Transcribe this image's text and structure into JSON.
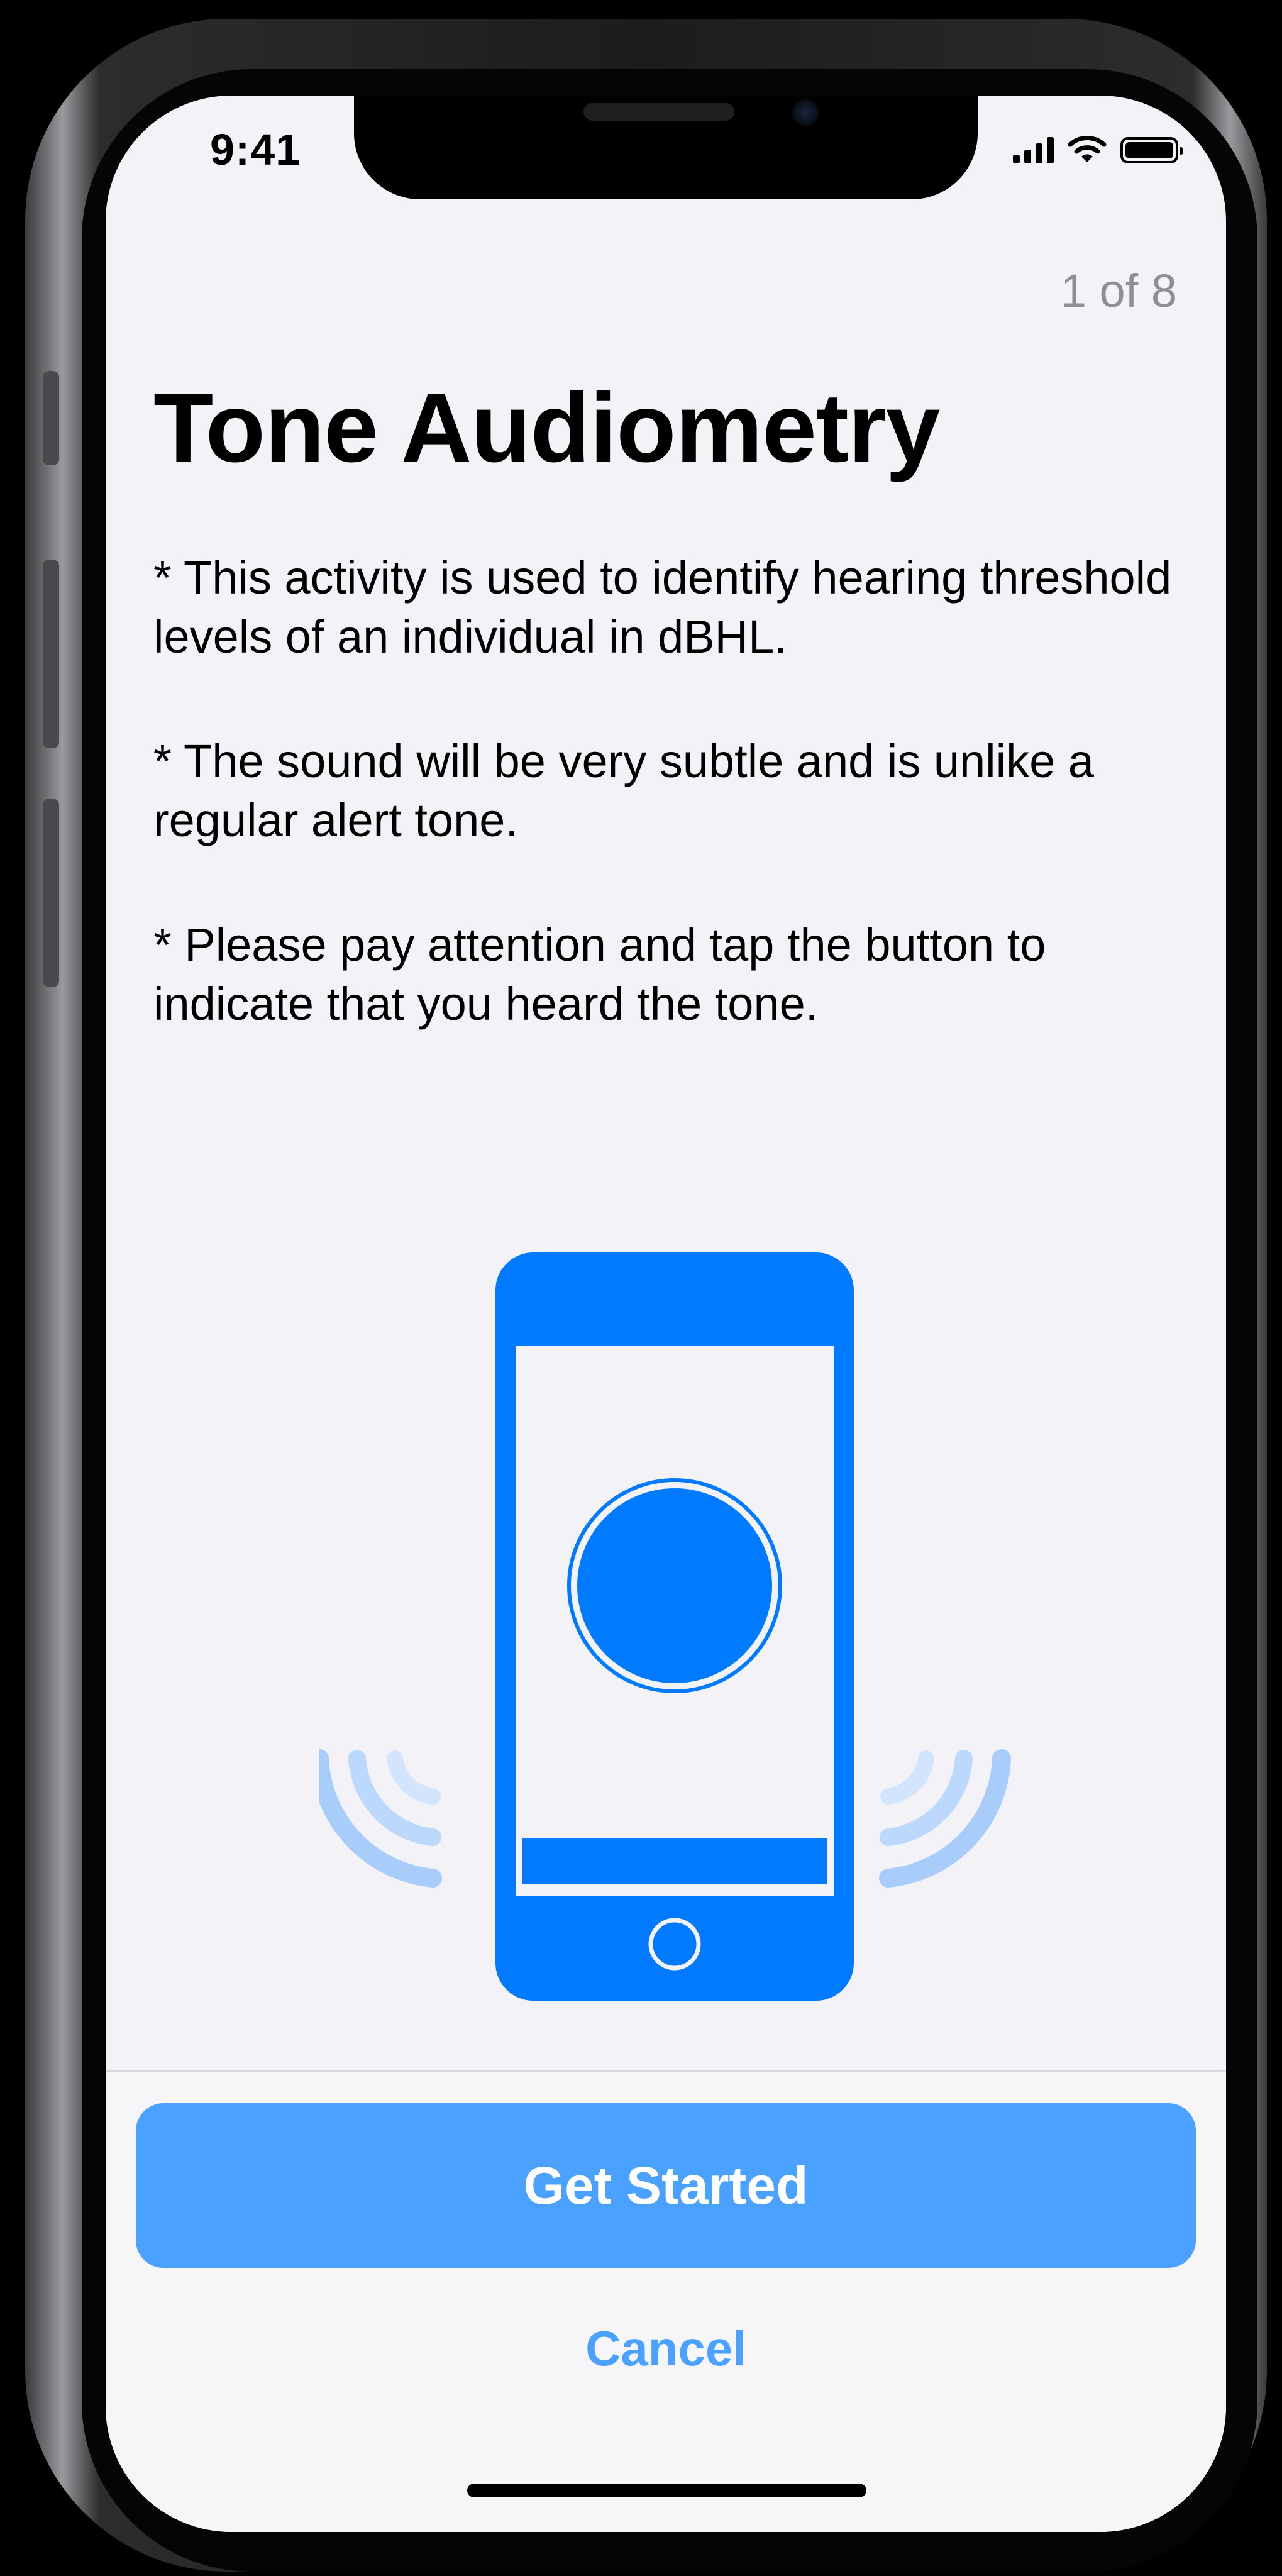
{
  "status_bar": {
    "time": "9:41"
  },
  "step_indicator": "1 of 8",
  "title": "Tone Audiometry",
  "instructions": [
    "* This activity is used to identify hearing threshold levels of an individual in dBHL.",
    "* The sound will be very subtle and is unlike a regular alert tone.",
    "* Please pay attention and tap the button to indicate that you heard the tone."
  ],
  "actions": {
    "primary_label": "Get Started",
    "secondary_label": "Cancel"
  },
  "colors": {
    "accent": "#007aff",
    "button": "#4aa1ff",
    "waves": "#a9cdfb",
    "background": "#f2f2f7"
  },
  "icons": {
    "illustration": "phone-tap-illustration-icon",
    "signal": "cellular-signal-icon",
    "wifi": "wifi-icon",
    "battery": "battery-icon"
  }
}
